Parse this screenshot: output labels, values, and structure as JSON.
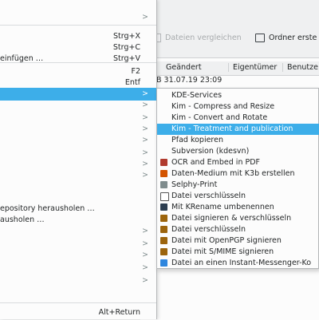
{
  "window": {
    "toolbar": {
      "compare_label": "Dateien vergleichen",
      "new_folder_label": "Ordner erste"
    },
    "columns": {
      "modified": "Geändert",
      "owner": "Eigentümer",
      "user": "Benutze"
    },
    "row1": {
      "text": "B  31.07.19 23:09"
    }
  },
  "context_menu": {
    "items": [
      {
        "label": "",
        "shortcut": "",
        "arrow": ">"
      },
      {
        "label": "",
        "shortcut": "Strg+X",
        "arrow": ""
      },
      {
        "label": "",
        "shortcut": "Strg+C",
        "arrow": ""
      },
      {
        "label": "einfügen …",
        "shortcut": "Strg+V",
        "arrow": ""
      },
      {
        "label": "",
        "shortcut": "F2",
        "arrow": ""
      },
      {
        "label": "",
        "shortcut": "Entf",
        "arrow": ""
      },
      {
        "label": "",
        "shortcut": "",
        "arrow": ">"
      },
      {
        "label": "",
        "shortcut": "",
        "arrow": ">"
      },
      {
        "label": "",
        "shortcut": "",
        "arrow": ">"
      },
      {
        "label": "",
        "shortcut": "",
        "arrow": ">"
      },
      {
        "label": "",
        "shortcut": "",
        "arrow": ">"
      },
      {
        "label": "",
        "shortcut": "",
        "arrow": ">"
      },
      {
        "label": "",
        "shortcut": "",
        "arrow": ">"
      },
      {
        "label": "",
        "shortcut": "",
        "arrow": ">"
      },
      {
        "label": "epository herausholen …",
        "shortcut": "",
        "arrow": ""
      },
      {
        "label": "ausholen …",
        "shortcut": "",
        "arrow": ""
      },
      {
        "label": "",
        "shortcut": "",
        "arrow": ">"
      },
      {
        "label": "",
        "shortcut": "",
        "arrow": ">"
      },
      {
        "label": "",
        "shortcut": "",
        "arrow": ">"
      },
      {
        "label": "",
        "shortcut": "",
        "arrow": ">"
      },
      {
        "label": "",
        "shortcut": "",
        "arrow": ">"
      },
      {
        "label": "",
        "shortcut": "Alt+Return",
        "arrow": ""
      }
    ]
  },
  "submenu": {
    "items": [
      {
        "label": "KDE-Services",
        "icon": ""
      },
      {
        "label": "Kim - Compress and Resize",
        "icon": ""
      },
      {
        "label": "Kim - Convert and Rotate",
        "icon": ""
      },
      {
        "label": "Kim - Treatment and publication",
        "icon": ""
      },
      {
        "label": "Pfad kopieren",
        "icon": ""
      },
      {
        "label": "Subversion (kdesvn)",
        "icon": ""
      },
      {
        "label": "OCR and Embed in PDF",
        "icon": "ocr-icon"
      },
      {
        "label": "Daten-Medium mit K3b erstellen",
        "icon": "k3b-icon"
      },
      {
        "label": "Selphy-Print",
        "icon": "printer-icon"
      },
      {
        "label": "Datei verschlüsseln",
        "icon": "lock-icon"
      },
      {
        "label": "Mit KRename umbenennen",
        "icon": "krename-icon"
      },
      {
        "label": "Datei signieren & verschlüsseln",
        "icon": "sign-encrypt-icon"
      },
      {
        "label": "Datei verschlüsseln",
        "icon": "encrypt-icon"
      },
      {
        "label": "Datei mit OpenPGP signieren",
        "icon": "openpgp-icon"
      },
      {
        "label": "Datei mit S/MIME signieren",
        "icon": "smime-icon"
      },
      {
        "label": "Datei an einen Instant-Messenger-Ko",
        "icon": "messenger-icon"
      }
    ]
  }
}
